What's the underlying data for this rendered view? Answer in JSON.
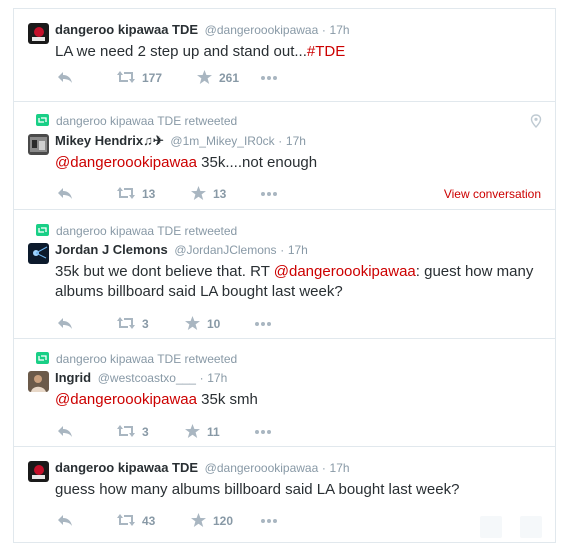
{
  "tweets": [
    {
      "name": "dangeroo kipawaa TDE",
      "handle": "@dangeroookipawaa",
      "time": "17h",
      "text_parts": [
        {
          "t": "LA we need 2 step up and stand out..."
        },
        {
          "t": "#TDE",
          "kind": "hashtag"
        }
      ],
      "retweets": "177",
      "likes": "261"
    },
    {
      "retweeted_by": "dangeroo kipawaa TDE retweeted",
      "name": "Mikey Hendrix♫✈",
      "handle": "@1m_Mikey_IR0ck",
      "time": "17h",
      "text_parts": [
        {
          "t": "@dangeroookipawaa",
          "kind": "mention"
        },
        {
          "t": " 35k....not enough"
        }
      ],
      "retweets": "13",
      "likes": "13",
      "view_conversation": "View conversation"
    },
    {
      "retweeted_by": "dangeroo kipawaa TDE retweeted",
      "name": "Jordan J Clemons",
      "handle": "@JordanJClemons",
      "time": "17h",
      "text_parts": [
        {
          "t": "35k but we dont believe that. RT "
        },
        {
          "t": "@dangeroookipawaa",
          "kind": "mention"
        },
        {
          "t": ": guest how many albums billboard said LA bought last week?"
        }
      ],
      "retweets": "3",
      "likes": "10"
    },
    {
      "retweeted_by": "dangeroo kipawaa TDE retweeted",
      "name": "Ingrid",
      "handle": "@westcoastxo___",
      "time": "17h",
      "text_parts": [
        {
          "t": "@dangeroookipawaa",
          "kind": "mention"
        },
        {
          "t": " 35k smh"
        }
      ],
      "retweets": "3",
      "likes": "11"
    },
    {
      "name": "dangeroo kipawaa TDE",
      "handle": "@dangeroookipawaa",
      "time": "17h",
      "text_parts": [
        {
          "t": "guess how many albums billboard said LA bought last week?"
        }
      ],
      "retweets": "43",
      "likes": "120"
    }
  ],
  "dot_separator": "·",
  "colors": {
    "link": "#cc0000",
    "muted": "#8899a6",
    "retweet_green": "#19cf86",
    "border": "#e1e8ed"
  },
  "icons": {
    "reply": "reply-icon",
    "retweet": "retweet-icon",
    "like": "star-icon",
    "more": "more-icon",
    "geo": "location-pin-icon"
  }
}
